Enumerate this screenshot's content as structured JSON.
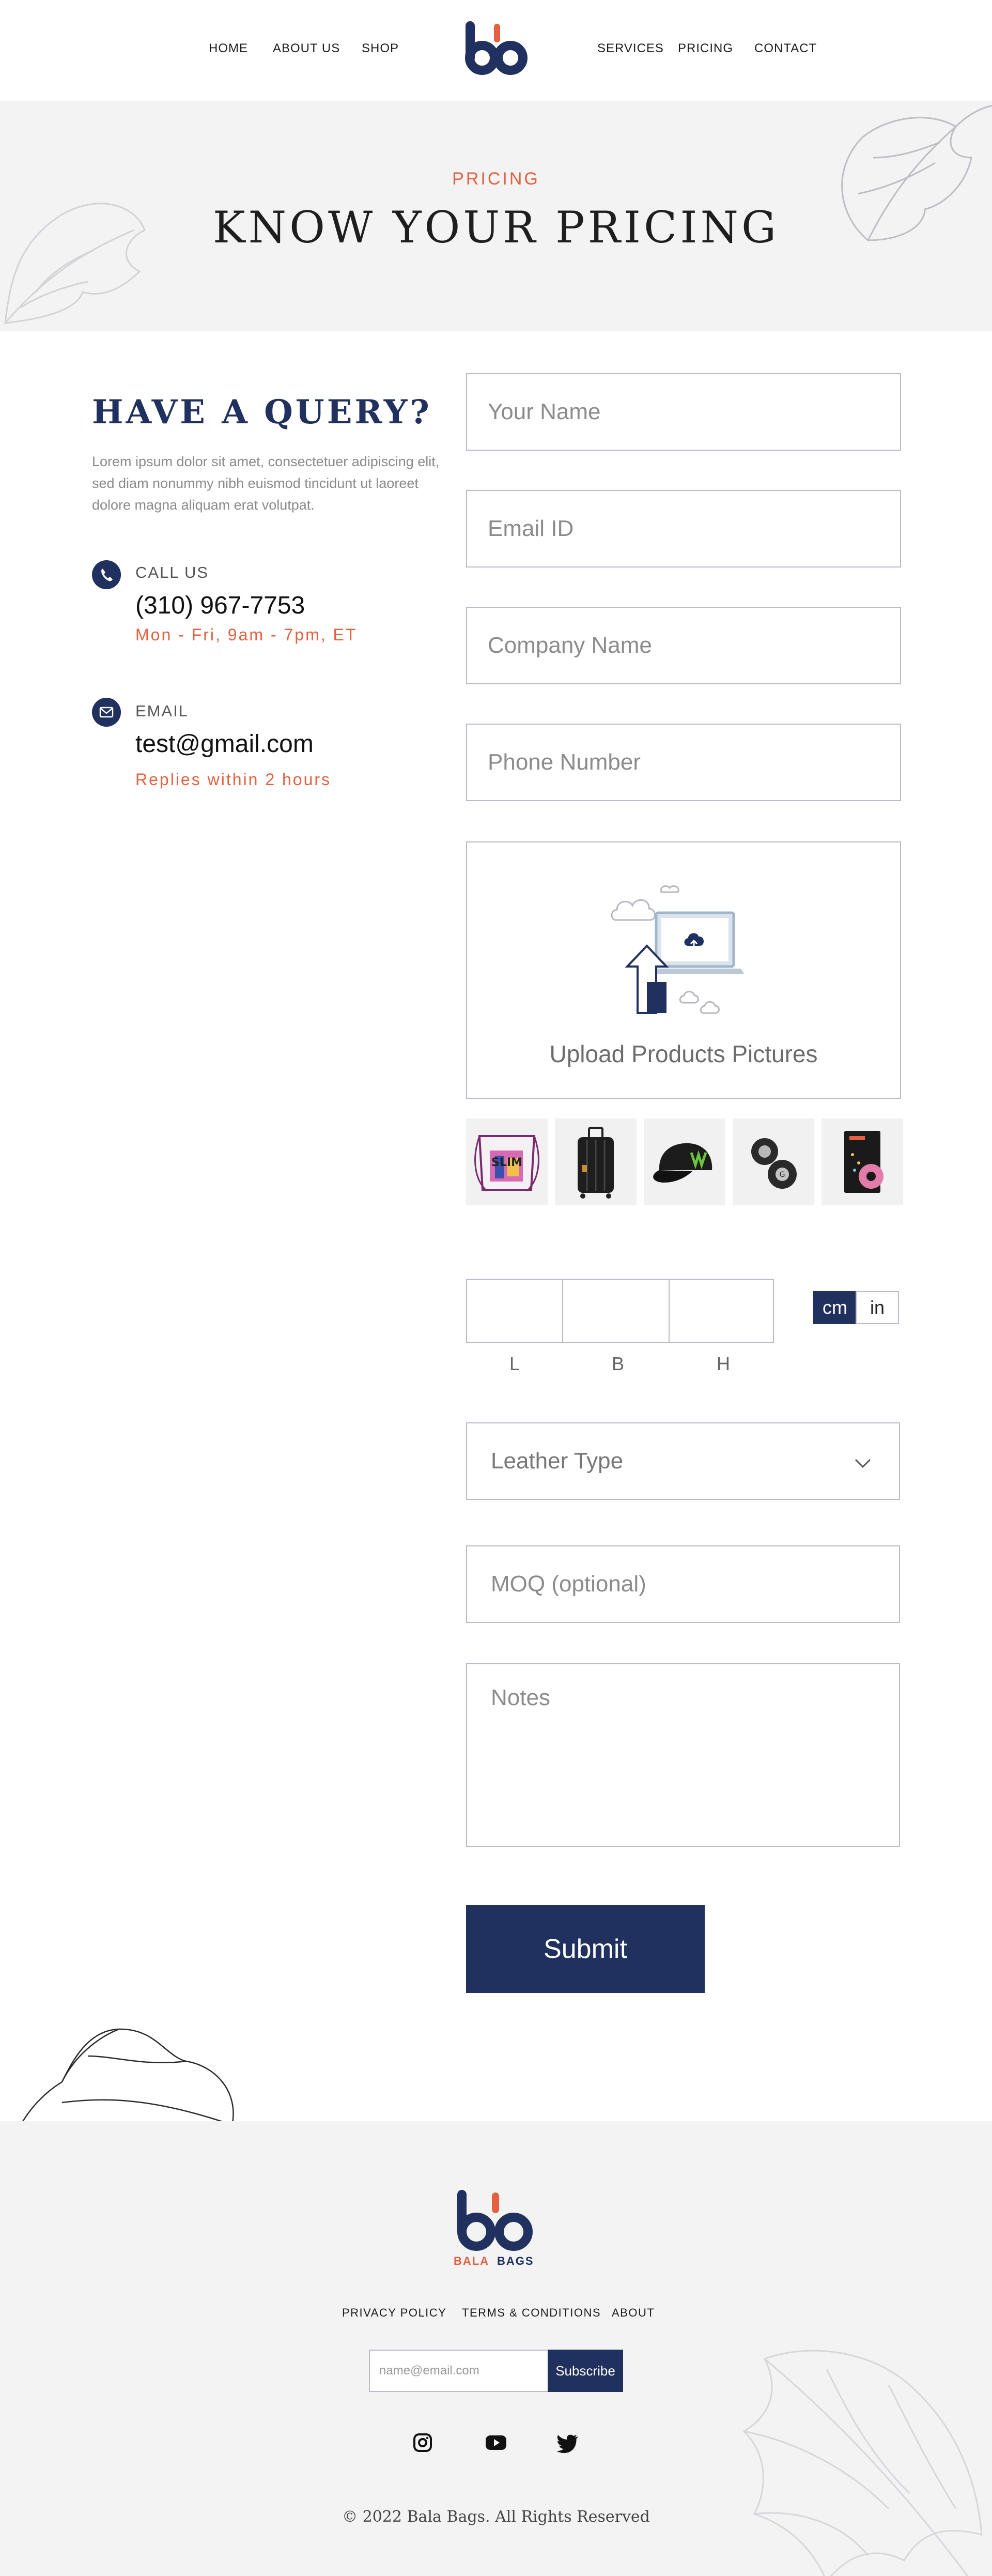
{
  "nav": {
    "left": [
      "HOME",
      "ABOUT US",
      "SHOP"
    ],
    "right": [
      "SERVICES",
      "PRICING",
      "CONTACT"
    ]
  },
  "hero": {
    "eyebrow": "PRICING",
    "title": "KNOW YOUR PRICING"
  },
  "contact": {
    "title": "HAVE A QUERY?",
    "description": "Lorem ipsum dolor sit amet, consectetuer adipiscing elit, sed diam nonummy nibh euismod tincidunt ut laoreet dolore magna aliquam erat volutpat.",
    "call": {
      "label": "CALL US",
      "value": "(310) 967-7753",
      "note": "Mon - Fri, 9am - 7pm, ET",
      "icon": "phone-icon"
    },
    "email": {
      "label": "EMAIL",
      "value": "test@gmail.com",
      "note": "Replies within 2 hours",
      "icon": "mail-icon"
    }
  },
  "form": {
    "name_placeholder": "Your Name",
    "email_placeholder": "Email ID",
    "company_placeholder": "Company Name",
    "phone_placeholder": "Phone Number",
    "upload_label": "Upload Products Pictures",
    "thumbnails": [
      "drawstring-bag",
      "suitcase",
      "cap",
      "earbuds",
      "notebook"
    ],
    "dimensions": {
      "length_label": "L",
      "breadth_label": "B",
      "height_label": "H"
    },
    "units": {
      "active": "cm",
      "inactive": "in"
    },
    "leather_type": "Leather Type",
    "moq_placeholder": "MOQ (optional)",
    "notes_placeholder": "Notes",
    "submit_label": "Submit"
  },
  "footer": {
    "logo_text_left": "BALA",
    "logo_text_right": "BAGS",
    "links": [
      "PRIVACY POLICY",
      "TERMS & CONDITIONS",
      "ABOUT"
    ],
    "newsletter_placeholder": "name@email.com",
    "subscribe_label": "Subscribe",
    "social": [
      "instagram-icon",
      "youtube-icon",
      "twitter-icon"
    ],
    "copyright": "© 2022 Bala Bags. All Rights Reserved"
  },
  "colors": {
    "brand_navy": "#20305f",
    "accent_orange": "#e5603f",
    "panel_gray": "#f3f3f4",
    "border_gray": "#b9bcc6"
  }
}
